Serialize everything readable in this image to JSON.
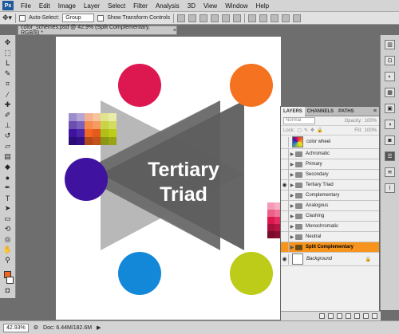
{
  "menubar": {
    "logo": "Ps",
    "items": [
      "File",
      "Edit",
      "Image",
      "Layer",
      "Select",
      "Filter",
      "Analysis",
      "3D",
      "View",
      "Window",
      "Help"
    ]
  },
  "options": {
    "auto_select_label": "Auto-Select:",
    "auto_select_value": "Group",
    "transform_label": "Show Transform Controls"
  },
  "document": {
    "tab_title": "color_schemes.psd @ 42.9% (Split Complementary, RGB/8) *",
    "title_line1": "Tertiary",
    "title_line2": "Triad"
  },
  "colors": {
    "top_left": "#dd1850",
    "top_right": "#f47220",
    "left": "#3f12a0",
    "bottom_left": "#1488d8",
    "bottom_right": "#bccc18",
    "triangle_dark": "#5e5e5e",
    "triangle_light": "#b2b2b2",
    "accent_fg": "#f26522"
  },
  "layers_panel": {
    "tabs": [
      "LAYERS",
      "CHANNELS",
      "PATHS"
    ],
    "blend_mode": "Normal",
    "opacity_label": "Opacity:",
    "opacity_value": "100%",
    "lock_label": "Lock:",
    "fill_label": "Fill:",
    "fill_value": "100%",
    "layers": [
      {
        "name": "color wheel",
        "visible": false,
        "type": "image",
        "selected": false
      },
      {
        "name": "Achromatic",
        "visible": false,
        "type": "group",
        "selected": false
      },
      {
        "name": "Primary",
        "visible": false,
        "type": "group",
        "selected": false
      },
      {
        "name": "Secondary",
        "visible": false,
        "type": "group",
        "selected": false
      },
      {
        "name": "Tertiary Triad",
        "visible": true,
        "type": "group",
        "selected": false
      },
      {
        "name": "Complementary",
        "visible": false,
        "type": "group",
        "selected": false
      },
      {
        "name": "Analogous",
        "visible": false,
        "type": "group",
        "selected": false
      },
      {
        "name": "Clashing",
        "visible": false,
        "type": "group",
        "selected": false
      },
      {
        "name": "Monochromatic",
        "visible": false,
        "type": "group",
        "selected": false
      },
      {
        "name": "Neutral",
        "visible": false,
        "type": "group",
        "selected": false
      },
      {
        "name": "Split Complementary",
        "visible": false,
        "type": "group",
        "selected": true
      },
      {
        "name": "Background",
        "visible": true,
        "type": "background",
        "selected": false
      }
    ]
  },
  "status": {
    "zoom": "42.93%",
    "doc_info": "Doc: 6.44M/182.6M"
  }
}
